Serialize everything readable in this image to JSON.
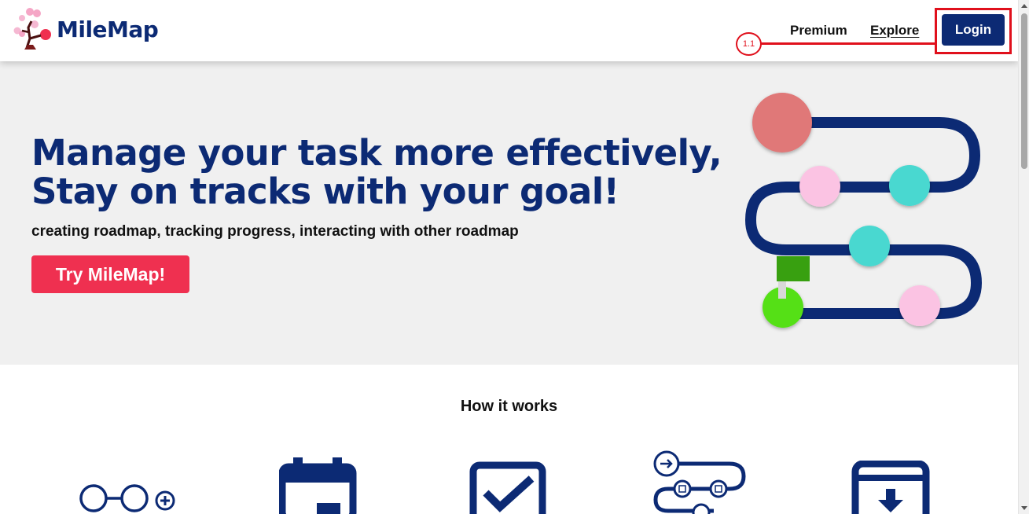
{
  "brand": {
    "name": "MileMap"
  },
  "nav": {
    "premium": "Premium",
    "explore": "Explore",
    "login": "Login"
  },
  "annotation": {
    "label": "1.1",
    "color": "#e0101c"
  },
  "hero": {
    "title_line1": "Manage your task more effectively,",
    "title_line2": "Stay on tracks with your goal!",
    "subtitle": "creating roadmap, tracking progress, interacting with other roadmap",
    "cta": "Try MileMap!"
  },
  "how_it_works": {
    "title": "How it works"
  },
  "colors": {
    "brand_navy": "#0c2a74",
    "cta_red": "#ef3050",
    "hero_bg": "#f0f0f0"
  },
  "icons": [
    "brand-logo-icon",
    "roadmap-illustration",
    "nodes-add-icon",
    "calendar-icon",
    "checkbox-icon",
    "steps-path-icon",
    "archive-download-icon"
  ]
}
